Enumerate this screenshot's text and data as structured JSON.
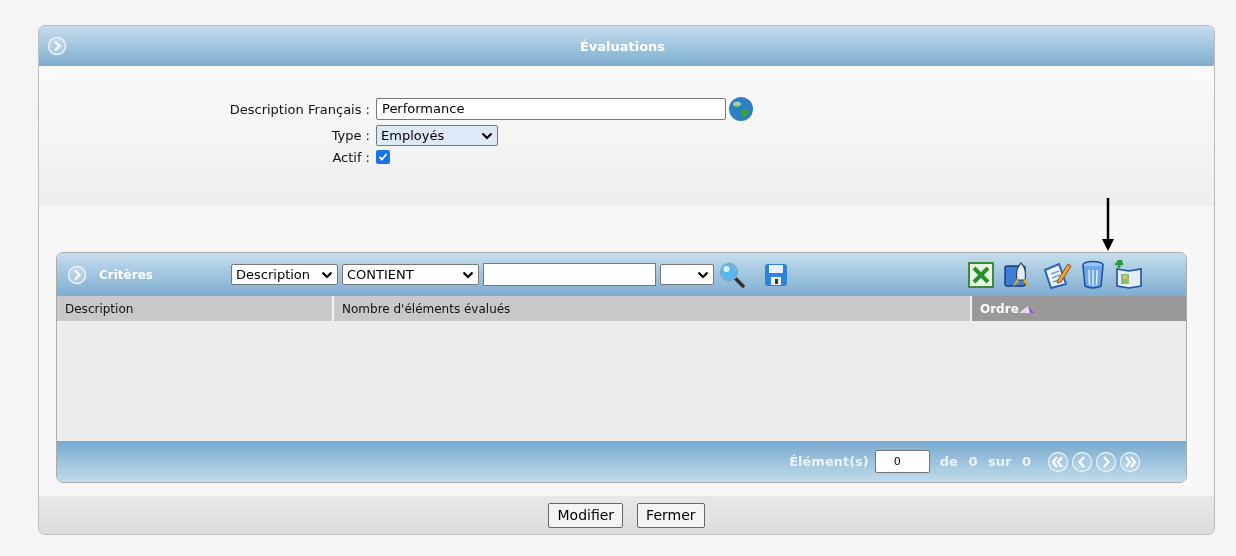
{
  "window": {
    "title": "Évaluations"
  },
  "form": {
    "fields": [
      {
        "kind": "text",
        "label": "Description Français :",
        "value": "Performance"
      },
      {
        "kind": "select",
        "label": "Type :",
        "value": "Employés"
      },
      {
        "kind": "checkbox",
        "label": "Actif :",
        "checked": true
      }
    ]
  },
  "grid": {
    "title": "Critères",
    "filter": {
      "field": "Description",
      "operator": "CONTIENT"
    },
    "columns": [
      {
        "label": "Description",
        "sorted": false
      },
      {
        "label": "Nombre d'éléments évalués",
        "sorted": false
      },
      {
        "label": "Ordre",
        "sorted": true
      }
    ],
    "pager": {
      "label": "Élément(s)",
      "value": "0",
      "summary": "de 0 sur 0"
    }
  },
  "buttons": [
    "Modifier",
    "Fermer"
  ]
}
